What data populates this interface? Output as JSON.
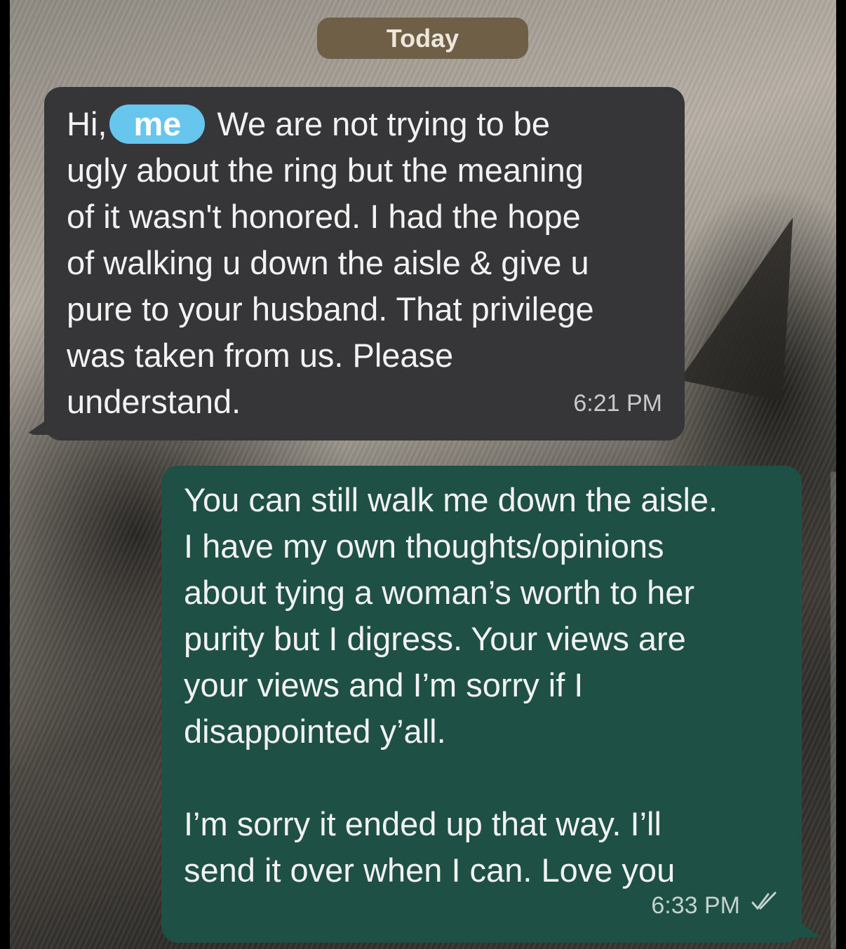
{
  "chat": {
    "date_separator": "Today",
    "incoming": {
      "greeting": "Hi,",
      "name_tag": "me",
      "text_after_name": " We are not trying to be\nugly about the ring but the meaning\nof it wasn't honored. I had the hope\nof walking u down the aisle & give u\npure to your husband. That privilege\nwas taken from us. Please\nunderstand.",
      "time": "6:21 PM"
    },
    "outgoing": {
      "text": "You can still walk me down the aisle.\nI have my own thoughts/opinions\nabout tying a woman’s worth to her\npurity but I digress. Your views are\nyour views and I’m sorry if I\ndisappointed y’all.\n\nI’m sorry it ended up that way. I’ll\nsend it over when I can. Love you",
      "time": "6:33 PM",
      "status_icon": "double-check-read-icon"
    }
  },
  "colors": {
    "incoming_bubble": "#363638",
    "outgoing_bubble": "#1f5045",
    "date_pill": "#6f5f47",
    "name_tag": "#66c6ee"
  }
}
